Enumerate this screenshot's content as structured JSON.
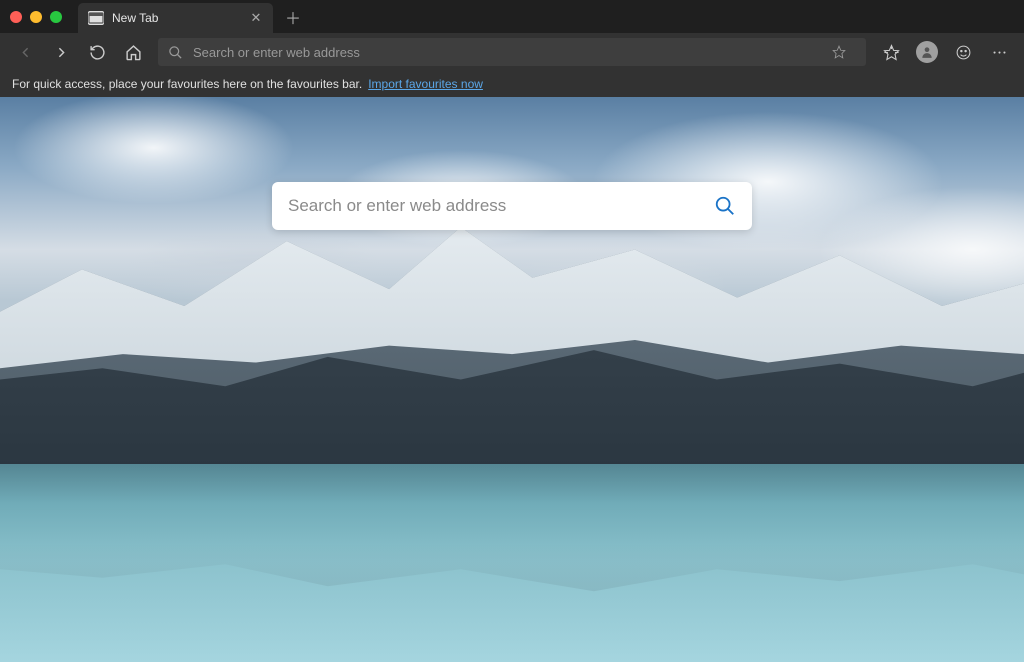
{
  "tab": {
    "title": "New Tab"
  },
  "toolbar": {
    "address_placeholder": "Search or enter web address"
  },
  "favourites_bar": {
    "hint_text": "For quick access, place your favourites here on the favourites bar.",
    "import_link": "Import favourites now"
  },
  "content": {
    "search_placeholder": "Search or enter web address"
  }
}
